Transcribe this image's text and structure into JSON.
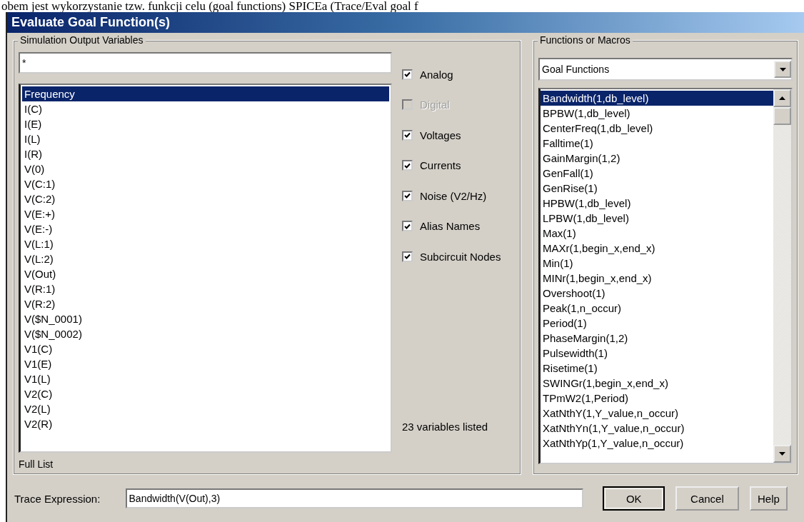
{
  "document_text": "obem jest wykorzystanie tzw. funkcji celu (goal functions) SPICEa (Trace/Eval goal f",
  "window": {
    "title": "Evaluate Goal Function(s)"
  },
  "variables": {
    "label": "Simulation Output Variables",
    "filter": "*",
    "items": [
      {
        "label": "Frequency",
        "selected": true
      },
      {
        "label": "I(C)",
        "selected": false
      },
      {
        "label": "I(E)",
        "selected": false
      },
      {
        "label": "I(L)",
        "selected": false
      },
      {
        "label": "I(R)",
        "selected": false
      },
      {
        "label": "V(0)",
        "selected": false
      },
      {
        "label": "V(C:1)",
        "selected": false
      },
      {
        "label": "V(C:2)",
        "selected": false
      },
      {
        "label": "V(E:+)",
        "selected": false
      },
      {
        "label": "V(E:-)",
        "selected": false
      },
      {
        "label": "V(L:1)",
        "selected": false
      },
      {
        "label": "V(L:2)",
        "selected": false
      },
      {
        "label": "V(Out)",
        "selected": false
      },
      {
        "label": "V(R:1)",
        "selected": false
      },
      {
        "label": "V(R:2)",
        "selected": false
      },
      {
        "label": "V($N_0001)",
        "selected": false
      },
      {
        "label": "V($N_0002)",
        "selected": false
      },
      {
        "label": "V1(C)",
        "selected": false
      },
      {
        "label": "V1(E)",
        "selected": false
      },
      {
        "label": "V1(L)",
        "selected": false
      },
      {
        "label": "V2(C)",
        "selected": false
      },
      {
        "label": "V2(L)",
        "selected": false
      },
      {
        "label": "V2(R)",
        "selected": false
      }
    ],
    "options": [
      {
        "label": "Analog",
        "checked": true,
        "disabled": false
      },
      {
        "label": "Digital",
        "checked": false,
        "disabled": true
      },
      {
        "label": "Voltages",
        "checked": true,
        "disabled": false
      },
      {
        "label": "Currents",
        "checked": true,
        "disabled": false
      },
      {
        "label": "Noise (V2/Hz)",
        "checked": true,
        "disabled": false
      },
      {
        "label": "Alias Names",
        "checked": true,
        "disabled": false
      },
      {
        "label": "Subcircuit Nodes",
        "checked": true,
        "disabled": false
      }
    ],
    "count": "23 variables listed",
    "footer": "Full List"
  },
  "functions": {
    "label": "Functions or Macros",
    "dropdown": "Goal Functions",
    "items": [
      {
        "label": "Bandwidth(1,db_level)",
        "selected": true
      },
      {
        "label": "BPBW(1,db_level)",
        "selected": false
      },
      {
        "label": "CenterFreq(1,db_level)",
        "selected": false
      },
      {
        "label": "Falltime(1)",
        "selected": false
      },
      {
        "label": "GainMargin(1,2)",
        "selected": false
      },
      {
        "label": "GenFall(1)",
        "selected": false
      },
      {
        "label": "GenRise(1)",
        "selected": false
      },
      {
        "label": "HPBW(1,db_level)",
        "selected": false
      },
      {
        "label": "LPBW(1,db_level)",
        "selected": false
      },
      {
        "label": "Max(1)",
        "selected": false
      },
      {
        "label": "MAXr(1,begin_x,end_x)",
        "selected": false
      },
      {
        "label": "Min(1)",
        "selected": false
      },
      {
        "label": "MINr(1,begin_x,end_x)",
        "selected": false
      },
      {
        "label": "Overshoot(1)",
        "selected": false
      },
      {
        "label": "Peak(1,n_occur)",
        "selected": false
      },
      {
        "label": "Period(1)",
        "selected": false
      },
      {
        "label": "PhaseMargin(1,2)",
        "selected": false
      },
      {
        "label": "Pulsewidth(1)",
        "selected": false
      },
      {
        "label": "Risetime(1)",
        "selected": false
      },
      {
        "label": "SWINGr(1,begin_x,end_x)",
        "selected": false
      },
      {
        "label": "TPmW2(1,Period)",
        "selected": false
      },
      {
        "label": "XatNthY(1,Y_value,n_occur)",
        "selected": false
      },
      {
        "label": "XatNthYn(1,Y_value,n_occur)",
        "selected": false
      },
      {
        "label": "XatNthYp(1,Y_value,n_occur)",
        "selected": false
      }
    ]
  },
  "trace": {
    "label": "Trace Expression:",
    "value": "Bandwidth(V(Out),3)"
  },
  "buttons": [
    "OK",
    "Cancel",
    "Help"
  ]
}
